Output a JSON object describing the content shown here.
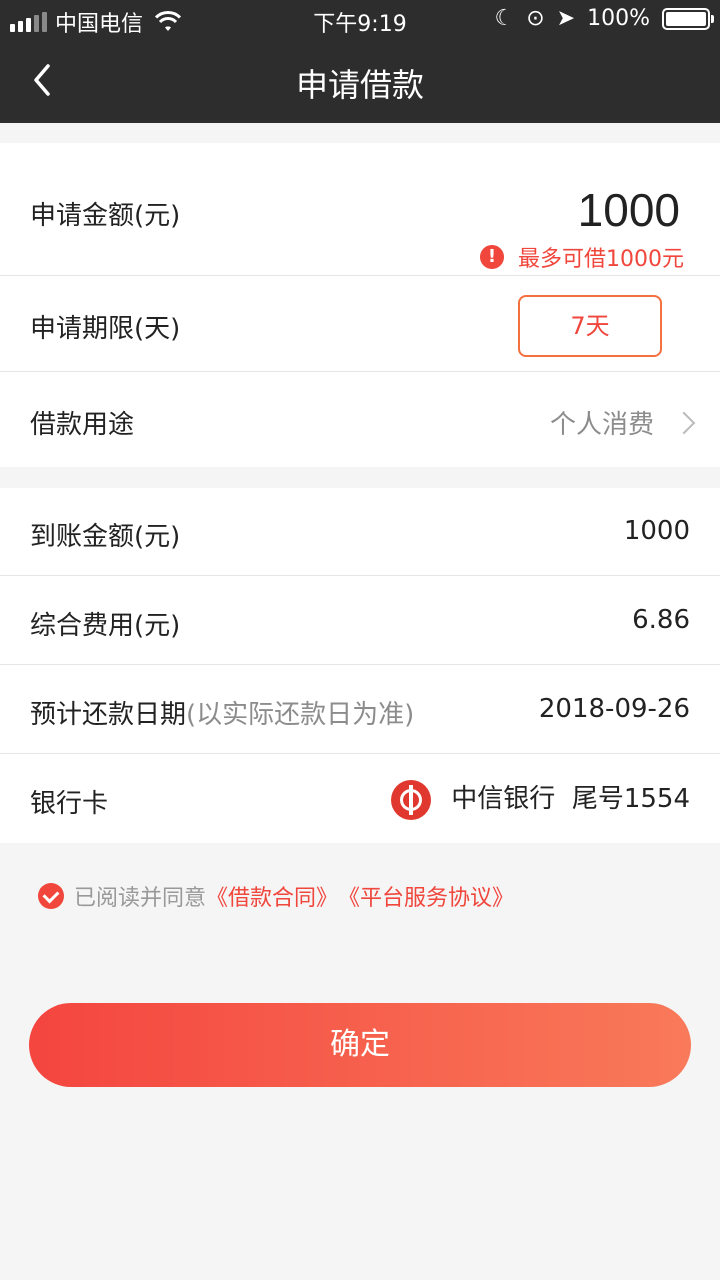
{
  "status_bar": {
    "carrier": "中国电信",
    "time": "下午9:19",
    "battery": "100%"
  },
  "nav": {
    "title": "申请借款"
  },
  "application": {
    "amount_label": "申请金额(元)",
    "amount_value": "1000",
    "amount_hint": "最多可借1000元",
    "term_label": "申请期限(天)",
    "term_value": "7天",
    "purpose_label": "借款用途",
    "purpose_value": "个人消费"
  },
  "details": {
    "received_label": "到账金额(元)",
    "received_value": "1000",
    "fee_label": "综合费用(元)",
    "fee_value": "6.86",
    "repay_label": "预计还款日期",
    "repay_note": "(以实际还款日为准)",
    "repay_value": "2018-09-26",
    "card_label": "银行卡",
    "bank_name": "中信银行",
    "card_tail": "尾号1554"
  },
  "agreement": {
    "prefix": "已阅读并同意",
    "contract_link": "《借款合同》",
    "service_link": "《平台服务协议》"
  },
  "actions": {
    "confirm_label": "确定"
  },
  "colors": {
    "accent": "#f0463c",
    "header_bg": "#2d2d2d"
  }
}
